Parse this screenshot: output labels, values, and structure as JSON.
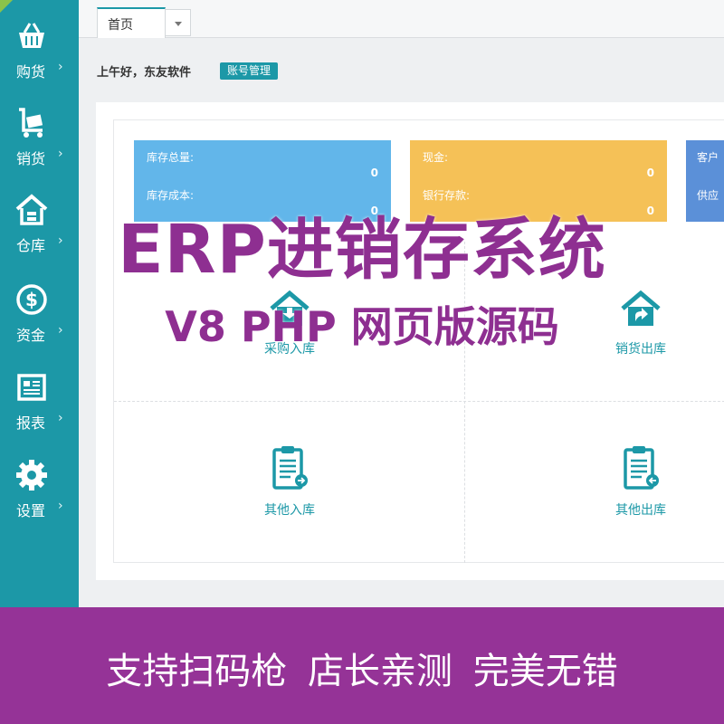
{
  "sidebar": {
    "items": [
      {
        "label": "购货",
        "icon": "basket-icon"
      },
      {
        "label": "销货",
        "icon": "cart-icon"
      },
      {
        "label": "仓库",
        "icon": "warehouse-icon"
      },
      {
        "label": "资金",
        "icon": "dollar-icon"
      },
      {
        "label": "报表",
        "icon": "report-icon"
      },
      {
        "label": "设置",
        "icon": "gear-icon"
      }
    ],
    "chevron": "›"
  },
  "tabs": {
    "home": "首页"
  },
  "header": {
    "greeting": "上午好，东友软件",
    "account_button": "账号管理"
  },
  "cards": {
    "blue": {
      "label1": "库存总量:",
      "value1": "0",
      "label2": "库存成本:",
      "value2": "0"
    },
    "yellow": {
      "label1": "现金:",
      "value1": "0",
      "label2": "银行存款:",
      "value2": "0"
    },
    "slate": {
      "label1": "客户",
      "label2": "供应"
    }
  },
  "quick_actions": {
    "purchase_in": "采购入库",
    "sales_out": "销货出库",
    "other_in": "其他入库",
    "other_out": "其他出库"
  },
  "promo": {
    "title": "ERP进销存系统",
    "subtitle": "V8 PHP 网页版源码",
    "banner": "支持扫码枪 店长亲测 完美无错"
  },
  "colors": {
    "sidebar": "#1c98a7",
    "accent": "#1c98a7",
    "promo": "#8e2f91",
    "banner": "#953397"
  }
}
